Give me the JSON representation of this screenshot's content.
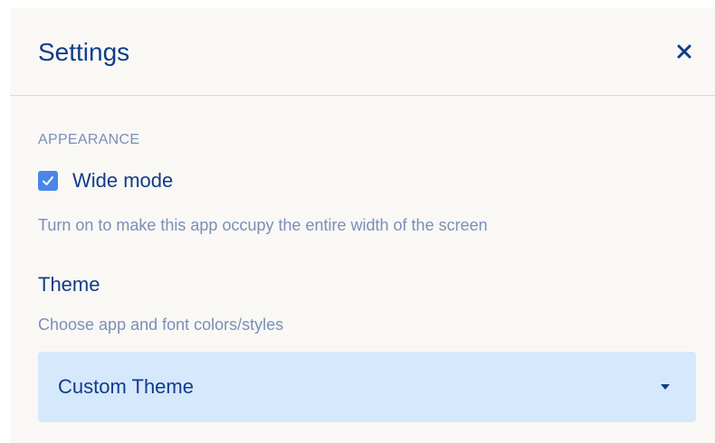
{
  "dialog": {
    "title": "Settings",
    "close_icon": "close-icon"
  },
  "appearance": {
    "section_label": "APPEARANCE",
    "wide_mode": {
      "label": "Wide mode",
      "checked": true,
      "description": "Turn on to make this app occupy the entire width of the screen"
    },
    "theme": {
      "title": "Theme",
      "description": "Choose app and font colors/styles",
      "selected": "Custom Theme",
      "chevron_icon": "chevron-down-icon"
    }
  },
  "colors": {
    "accent": "#0f3d8a",
    "muted": "#7a8fb8",
    "checkbox": "#4a86e8",
    "select_bg": "#d6e8fb",
    "dialog_bg": "#faf8f5"
  }
}
